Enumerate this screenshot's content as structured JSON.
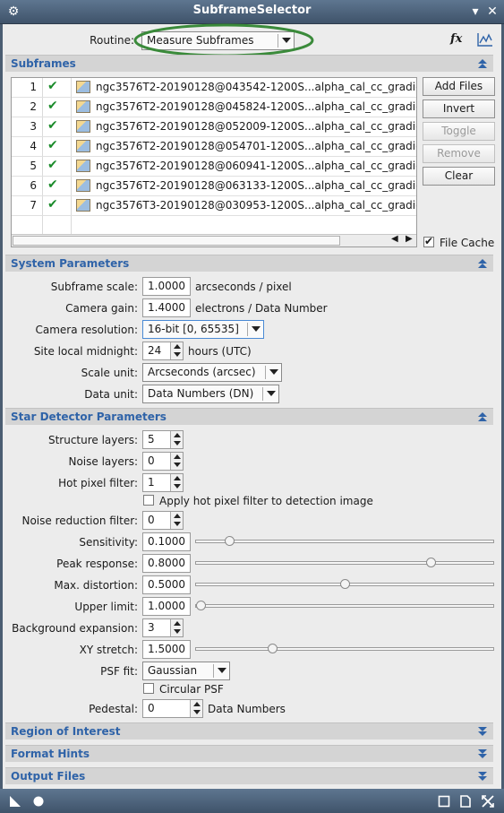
{
  "window": {
    "title": "SubframeSelector"
  },
  "routine": {
    "label": "Routine:",
    "value": "Measure Subframes"
  },
  "top_icons": {
    "fx": "fx",
    "chart": "chart-icon"
  },
  "sections": {
    "subframes": "Subframes",
    "system": "System Parameters",
    "star": "Star Detector Parameters",
    "roi": "Region of Interest",
    "format": "Format Hints",
    "output": "Output Files"
  },
  "subframes": {
    "files": [
      {
        "index": "1",
        "name": "ngc3576T2-20190128@043542-1200S...alpha_cal_cc_gradient_"
      },
      {
        "index": "2",
        "name": "ngc3576T2-20190128@045824-1200S...alpha_cal_cc_gradient_"
      },
      {
        "index": "3",
        "name": "ngc3576T2-20190128@052009-1200S...alpha_cal_cc_gradient_"
      },
      {
        "index": "4",
        "name": "ngc3576T2-20190128@054701-1200S...alpha_cal_cc_gradient_"
      },
      {
        "index": "5",
        "name": "ngc3576T2-20190128@060941-1200S...alpha_cal_cc_gradient_"
      },
      {
        "index": "6",
        "name": "ngc3576T2-20190128@063133-1200S...alpha_cal_cc_gradient_"
      },
      {
        "index": "7",
        "name": "ngc3576T3-20190128@030953-1200S...alpha_cal_cc_gradient_"
      }
    ],
    "buttons": {
      "add": "Add Files",
      "invert": "Invert",
      "toggle": "Toggle",
      "remove": "Remove",
      "clear": "Clear"
    },
    "file_cache": {
      "label": "File Cache",
      "checked": true
    }
  },
  "system": {
    "scale": {
      "label": "Subframe scale:",
      "value": "1.0000",
      "unit": "arcseconds / pixel"
    },
    "gain": {
      "label": "Camera gain:",
      "value": "1.4000",
      "unit": "electrons / Data Number"
    },
    "resolution": {
      "label": "Camera resolution:",
      "value": "16-bit [0, 65535]"
    },
    "midnight": {
      "label": "Site local midnight:",
      "value": "24",
      "unit": "hours (UTC)"
    },
    "scale_unit": {
      "label": "Scale unit:",
      "value": "Arcseconds (arcsec)"
    },
    "data_unit": {
      "label": "Data unit:",
      "value": "Data Numbers (DN)"
    }
  },
  "star": {
    "structure": {
      "label": "Structure layers:",
      "value": "5"
    },
    "noise": {
      "label": "Noise layers:",
      "value": "0"
    },
    "hotpixel": {
      "label": "Hot pixel filter:",
      "value": "1"
    },
    "apply_hot": {
      "label": "Apply hot pixel filter to detection image",
      "checked": false
    },
    "noise_reduction": {
      "label": "Noise reduction filter:",
      "value": "0"
    },
    "sensitivity": {
      "label": "Sensitivity:",
      "value": "0.1000",
      "level": 0.1
    },
    "peak": {
      "label": "Peak response:",
      "value": "0.8000",
      "level": 0.8
    },
    "distortion": {
      "label": "Max. distortion:",
      "value": "0.5000",
      "level": 0.5
    },
    "upper": {
      "label": "Upper limit:",
      "value": "1.0000",
      "level": 0.0
    },
    "bg_expansion": {
      "label": "Background expansion:",
      "value": "3"
    },
    "xy_stretch": {
      "label": "XY stretch:",
      "value": "1.5000",
      "level": 0.25
    },
    "psf_fit": {
      "label": "PSF fit:",
      "value": "Gaussian"
    },
    "circular": {
      "label": "Circular PSF",
      "checked": false
    },
    "pedestal": {
      "label": "Pedestal:",
      "value": "0",
      "unit": "Data Numbers"
    }
  },
  "colors": {
    "accent": "#2f63a8",
    "check": "#1a8b2a",
    "highlight": "#3a8a3a",
    "titlebar": "#4b5d72"
  }
}
